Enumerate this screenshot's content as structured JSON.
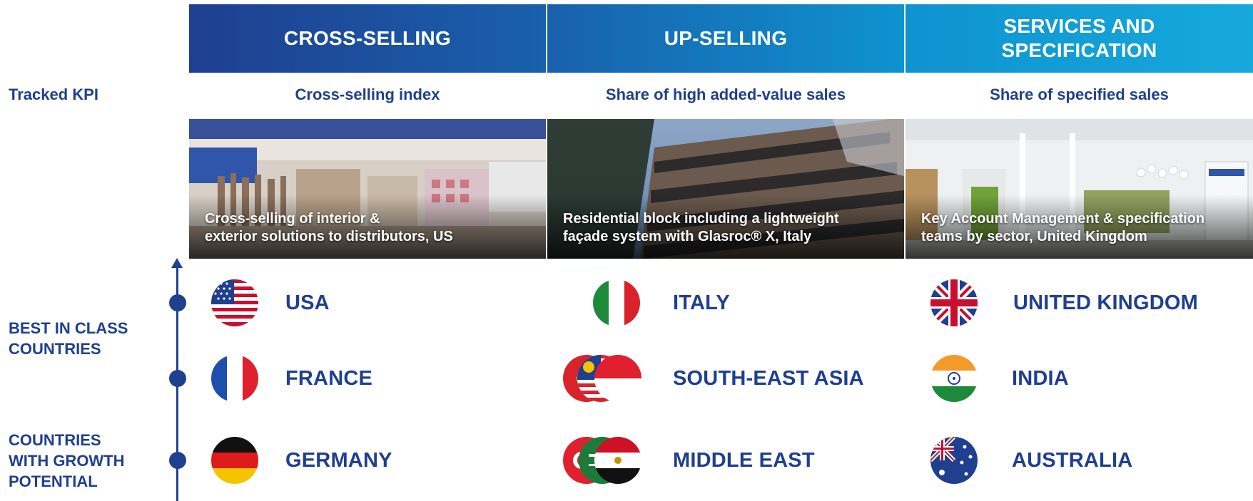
{
  "columns": [
    {
      "header": "CROSS-SELLING",
      "kpi": "Cross-selling index",
      "caption": "Cross-selling of interior &\nexterior solutions to distributors, US",
      "countries": [
        "USA",
        "FRANCE",
        "GERMANY"
      ]
    },
    {
      "header": "UP-SELLING",
      "kpi": "Share of high added-value sales",
      "caption": "Residential block including a lightweight\nfaçade system with Glasroc® X, Italy",
      "countries": [
        "ITALY",
        "SOUTH-EAST ASIA",
        "MIDDLE EAST"
      ]
    },
    {
      "header": "SERVICES AND\nSPECIFICATION",
      "kpi": "Share of specified sales",
      "caption": "Key Account Management & specification\nteams by sector, United Kingdom",
      "countries": [
        "UNITED KINGDOM",
        "INDIA",
        "AUSTRALIA"
      ]
    }
  ],
  "row_label_kpi": "Tracked KPI",
  "best_in_class_label": "BEST IN CLASS\nCOUNTRIES",
  "growth_label": "COUNTRIES\nWITH GROWTH\nPOTENTIAL",
  "colors": {
    "brand_dark": "#1f3f8f",
    "brand_light": "#16a9dc"
  }
}
